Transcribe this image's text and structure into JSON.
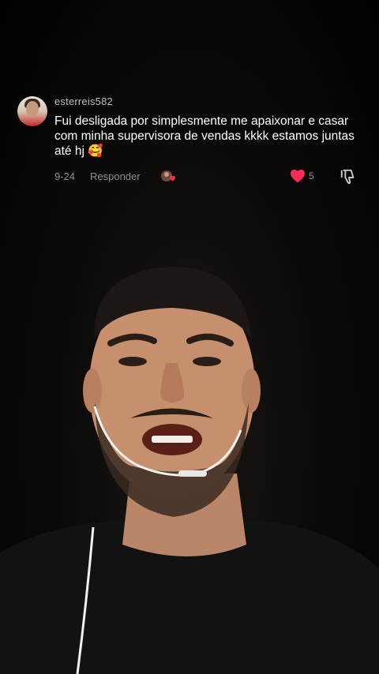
{
  "comment": {
    "username": "esterreis582",
    "text": "Fui desligada por simplesmente me apaixonar e casar com minha supervisora de vendas kkkk estamos juntas até hj",
    "emoji": "🥰",
    "date": "9-24",
    "reply_label": "Responder",
    "like_count": "5",
    "like_color": "#fe2c55"
  },
  "icons": {
    "like": "heart-icon",
    "dislike": "thumbs-down-icon",
    "reaction": "creator-liked-avatar-icon"
  }
}
